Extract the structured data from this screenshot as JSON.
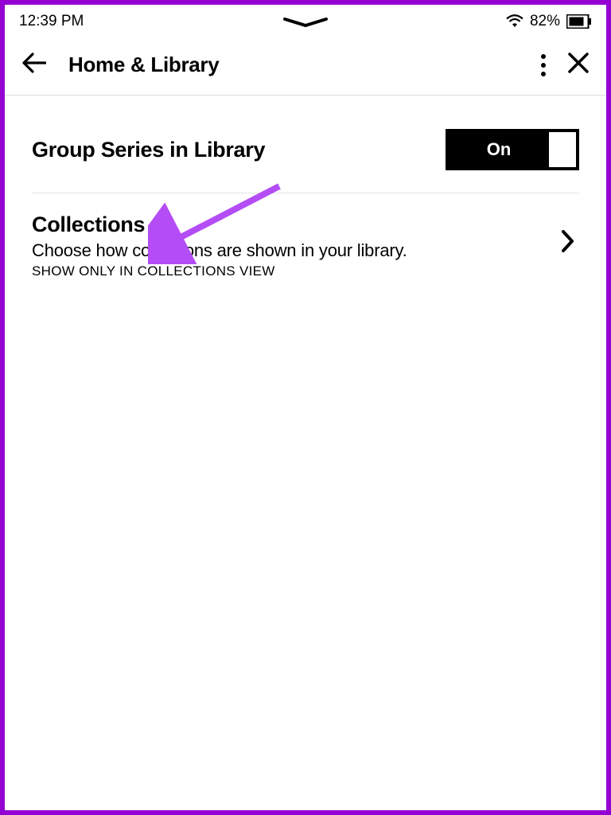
{
  "statusBar": {
    "time": "12:39 PM",
    "battery": "82%"
  },
  "header": {
    "title": "Home & Library"
  },
  "settings": {
    "groupSeries": {
      "title": "Group Series in Library",
      "toggleLabel": "On"
    },
    "collections": {
      "title": "Collections",
      "description": "Choose how collections are shown in your library.",
      "subtext": "SHOW ONLY IN COLLECTIONS VIEW"
    }
  }
}
